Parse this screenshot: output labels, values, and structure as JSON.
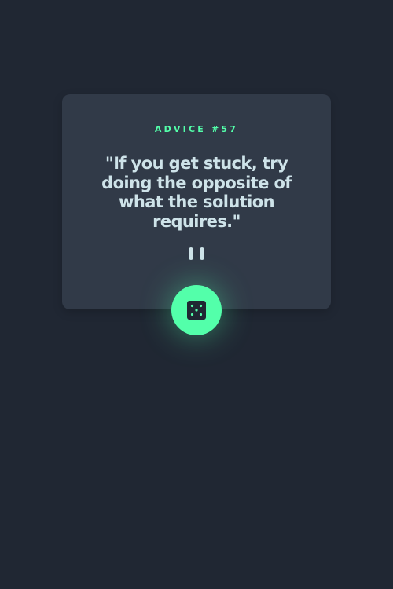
{
  "advice": {
    "id_label": "ADVICE #57",
    "quote": "\"If you get stuck, try doing the opposite of what the solution requires.\""
  },
  "divider": {
    "icon": "pause-icon"
  },
  "button": {
    "icon": "dice-icon"
  },
  "colors": {
    "background": "#202733",
    "card": "#313a48",
    "accent": "#53ffaa",
    "text": "#cee3e9",
    "divider": "#4f5d74"
  }
}
